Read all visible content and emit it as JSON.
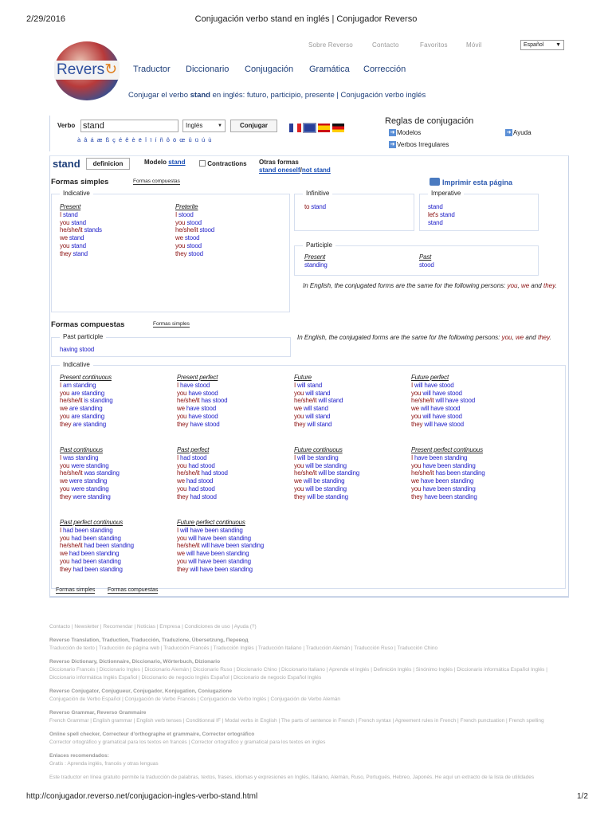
{
  "print_header": {
    "date": "2/29/2016",
    "title": "Conjugación verbo stand en inglés | Conjugador Reverso"
  },
  "print_footer": {
    "url": "http://conjugador.reverso.net/conjugacion-ingles-verbo-stand.html",
    "page": "1/2"
  },
  "logo": {
    "text": "Revers"
  },
  "top_links": [
    "Sobre Reverso",
    "Contacto",
    "Favoritos",
    "Móvil"
  ],
  "language_select": "Español",
  "nav": [
    "Traductor",
    "Diccionario",
    "Conjugación",
    "Gramática",
    "Corrección"
  ],
  "subtitle": {
    "pre": "Conjugar el verbo ",
    "verb": "stand",
    "post": " en inglés: futuro, participio, presente | Conjugación verbo inglés"
  },
  "search": {
    "label": "Verbo",
    "value": "stand",
    "language": "Inglés",
    "button": "Conjugar",
    "accents": "à â á æ ß ç é ê è ë î ï í ñ ô ö œ û ü ú ù"
  },
  "rules": {
    "title": "Reglas de conjugación",
    "modelos": "Modelos",
    "ayuda": "Ayuda",
    "irregulares": "Verbos Irregulares"
  },
  "verb_bar": {
    "verb": "stand",
    "definicion": "definicion",
    "modelo_label": "Modelo",
    "modelo": "stand",
    "contractions": "Contractions",
    "otras_label": "Otras formas",
    "otra1": "stand oneself",
    "sep": "/",
    "otra2": "not stand"
  },
  "simple": {
    "title": "Formas simples",
    "tab": "Formas compuestas",
    "print": "Imprimir esta página",
    "indicative_label": "Indicative",
    "infinitive_label": "Infinitive",
    "imperative_label": "Imperative",
    "participle_label": "Participle",
    "infinitive": [
      [
        "to ",
        "stand"
      ]
    ],
    "imperative": [
      [
        "",
        "stand"
      ],
      [
        "let's ",
        "stand"
      ],
      [
        "",
        "stand"
      ]
    ],
    "participle": [
      {
        "name": "Present",
        "value": "standing"
      },
      {
        "name": "Past",
        "value": "stood"
      }
    ],
    "indicative": [
      {
        "name": "Present",
        "forms": [
          [
            "I ",
            "stand"
          ],
          [
            "you ",
            "stand"
          ],
          [
            "he/she/it ",
            "stands"
          ],
          [
            "we ",
            "stand"
          ],
          [
            "you ",
            "stand"
          ],
          [
            "they ",
            "stand"
          ]
        ]
      },
      {
        "name": "Preterite",
        "forms": [
          [
            "I ",
            "stood"
          ],
          [
            "you ",
            "stood"
          ],
          [
            "he/she/it ",
            "stood"
          ],
          [
            "we ",
            "stood"
          ],
          [
            "you ",
            "stood"
          ],
          [
            "they ",
            "stood"
          ]
        ]
      }
    ]
  },
  "note": {
    "text": "In English, the conjugated forms are the same for the following persons: ",
    "p1": "you",
    "p2": "we",
    "and": " and ",
    "p3": "they"
  },
  "compound": {
    "title": "Formas compuestas",
    "tab": "Formas simples",
    "past_participle_label": "Past participle",
    "past_participle": "having stood",
    "indicative_label": "Indicative",
    "indicative": [
      {
        "name": "Present continuous",
        "forms": [
          [
            "I ",
            "am standing"
          ],
          [
            "you ",
            "are standing"
          ],
          [
            "he/she/it ",
            "is standing"
          ],
          [
            "we ",
            "are standing"
          ],
          [
            "you ",
            "are standing"
          ],
          [
            "they ",
            "are standing"
          ]
        ]
      },
      {
        "name": "Present perfect",
        "forms": [
          [
            "I ",
            "have stood"
          ],
          [
            "you ",
            "have stood"
          ],
          [
            "he/she/it ",
            "has stood"
          ],
          [
            "we ",
            "have stood"
          ],
          [
            "you ",
            "have stood"
          ],
          [
            "they ",
            "have stood"
          ]
        ]
      },
      {
        "name": "Future",
        "forms": [
          [
            "I ",
            "will stand"
          ],
          [
            "you ",
            "will stand"
          ],
          [
            "he/she/it ",
            "will stand"
          ],
          [
            "we ",
            "will stand"
          ],
          [
            "you ",
            "will stand"
          ],
          [
            "they ",
            "will stand"
          ]
        ]
      },
      {
        "name": "Future perfect",
        "forms": [
          [
            "I ",
            "will have stood"
          ],
          [
            "you ",
            "will have stood"
          ],
          [
            "he/she/it ",
            "will have stood"
          ],
          [
            "we ",
            "will have stood"
          ],
          [
            "you ",
            "will have stood"
          ],
          [
            "they ",
            "will have stood"
          ]
        ]
      },
      {
        "name": "Past continuous",
        "forms": [
          [
            "I ",
            "was standing"
          ],
          [
            "you ",
            "were standing"
          ],
          [
            "he/she/it ",
            "was standing"
          ],
          [
            "we ",
            "were standing"
          ],
          [
            "you ",
            "were standing"
          ],
          [
            "they ",
            "were standing"
          ]
        ]
      },
      {
        "name": "Past perfect",
        "forms": [
          [
            "I ",
            "had stood"
          ],
          [
            "you ",
            "had stood"
          ],
          [
            "he/she/it ",
            "had stood"
          ],
          [
            "we ",
            "had stood"
          ],
          [
            "you ",
            "had stood"
          ],
          [
            "they ",
            "had stood"
          ]
        ]
      },
      {
        "name": "Future continuous",
        "forms": [
          [
            "I ",
            "will be standing"
          ],
          [
            "you ",
            "will be standing"
          ],
          [
            "he/she/it ",
            "will be standing"
          ],
          [
            "we ",
            "will be standing"
          ],
          [
            "you ",
            "will be standing"
          ],
          [
            "they ",
            "will be standing"
          ]
        ]
      },
      {
        "name": "Present perfect continuous",
        "forms": [
          [
            "I ",
            "have been standing"
          ],
          [
            "you ",
            "have been standing"
          ],
          [
            "he/she/it ",
            "has been standing"
          ],
          [
            "we ",
            "have been standing"
          ],
          [
            "you ",
            "have been standing"
          ],
          [
            "they ",
            "have been standing"
          ]
        ]
      },
      {
        "name": "Past perfect continuous",
        "forms": [
          [
            "I ",
            "had been standing"
          ],
          [
            "you ",
            "had been standing"
          ],
          [
            "he/she/it ",
            "had been standing"
          ],
          [
            "we ",
            "had been standing"
          ],
          [
            "you ",
            "had been standing"
          ],
          [
            "they ",
            "had been standing"
          ]
        ]
      },
      {
        "name": "Future perfect continuous",
        "forms": [
          [
            "I ",
            "will have been standing"
          ],
          [
            "you ",
            "will have been standing"
          ],
          [
            "he/she/it ",
            "will have been standing"
          ],
          [
            "we ",
            "will have been standing"
          ],
          [
            "you ",
            "will have been standing"
          ],
          [
            "they ",
            "will have been standing"
          ]
        ]
      }
    ]
  },
  "bottom_tabs": [
    "Formas simples",
    "Formas compuestas"
  ],
  "footer": [
    {
      "text": "Contacto | Newsletter | Recomendar | Noticias | Empresa | Condiciones de uso | Ayuda (?)"
    },
    {
      "title": "Reverso Translation, Traduction, Traducción, Traduzione, Übersetzung, Перевод",
      "text": "Traducción de texto | Traducción de página web | Traducción Francés | Traducción Inglés | Traducción Italiano | Traducción Alemán | Traducción Ruso | Traducción Chino"
    },
    {
      "title": "Reverso Dictionary, Dictionnaire, Diccionario, Wörterbuch, Dizionario",
      "text": "Diccionario Francés | Diccionario Ingles | Diccionario Alemán | Diccionario Ruso | Diccionario Chino | Diccionario Italiano | Aprende el Inglés | Definición Inglés | Sinónimo Inglés | Diccionario informática Español Inglés | Diccionario informática Inglés Español | Diccionario de negocio Inglés Español | Diccionario de negocio Español Inglés"
    },
    {
      "title": "Reverso Conjugator, Conjugueur, Conjugador, Konjugation, Coniugazione",
      "text": "Conjugación de Verbo Español | Conjugación de Verbo Francés | Conjugación de Verbo Inglés | Conjugación de Verbo Alemán"
    },
    {
      "title": "Reverso Grammar, Reverso Grammaire",
      "text": "French Grammar | English grammar | English verb tenses | Conditionnal IF | Modal verbs in English | The parts of sentence in French | French syntax | Agreement rules in French | French punctuation | French spelling"
    },
    {
      "title": "Online spell checker, Correcteur d'orthographe et grammaire, Corrector ortográfico",
      "text": "Corrector ortográfico y gramatical para los textos en francés | Corrector ortográfico y gramatical para los textos en ingles"
    },
    {
      "title": "Enlaces recomendados:",
      "text": "Gratis : Aprenda inglés, francés y otras lenguas"
    },
    {
      "text": "Este traductor en línea gratuito permite la traducción de palabras, textos, frases, idiomas y expresiones en Inglés, Italiano, Alemán, Ruso, Portugués, Hebreo, Japonés. He aquí un extracto de la lista de utilidades"
    }
  ],
  "colors": {
    "pronoun": "#8b1010",
    "verb": "#1f1fc8",
    "link": "#1a4fb5"
  }
}
